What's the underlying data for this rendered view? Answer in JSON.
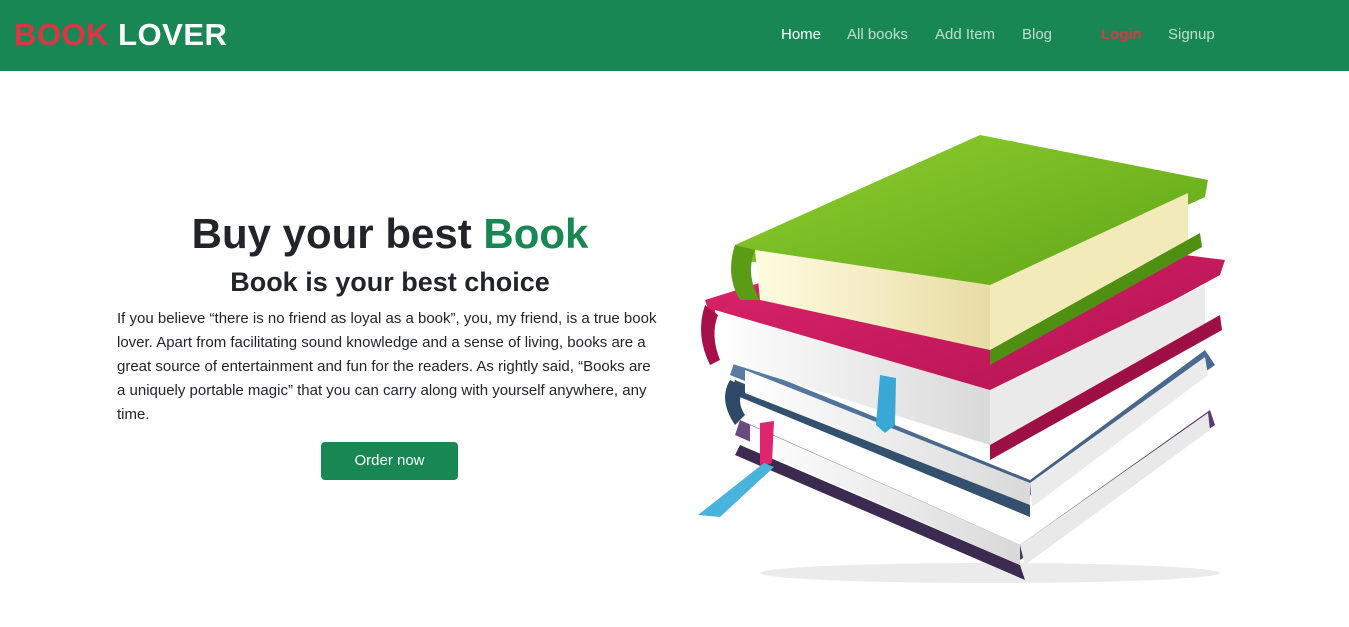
{
  "brand": {
    "word1": "BOOK",
    "word2": "LOVER"
  },
  "nav": {
    "home": "Home",
    "all_books": "All books",
    "add_item": "Add Item",
    "blog": "Blog",
    "login": "Login",
    "signup": "Signup"
  },
  "hero": {
    "title_prefix": "Buy your best",
    "title_accent": "Book",
    "subtitle": "Book is your best choice",
    "paragraph": "If you believe “there is no friend as loyal as a book”, you, my friend, is a true book lover. Apart from facilitating sound knowledge and a sense of living, books are a great source of entertainment and fun for the readers. As rightly said, “Books are a uniquely portable magic” that you can carry along with yourself anywhere, any time.",
    "button_label": "Order now",
    "image_icon": "stack-of-books-illustration"
  },
  "colors": {
    "primary": "#198754",
    "danger": "#dc3545",
    "text": "#212529",
    "white": "#ffffff"
  }
}
